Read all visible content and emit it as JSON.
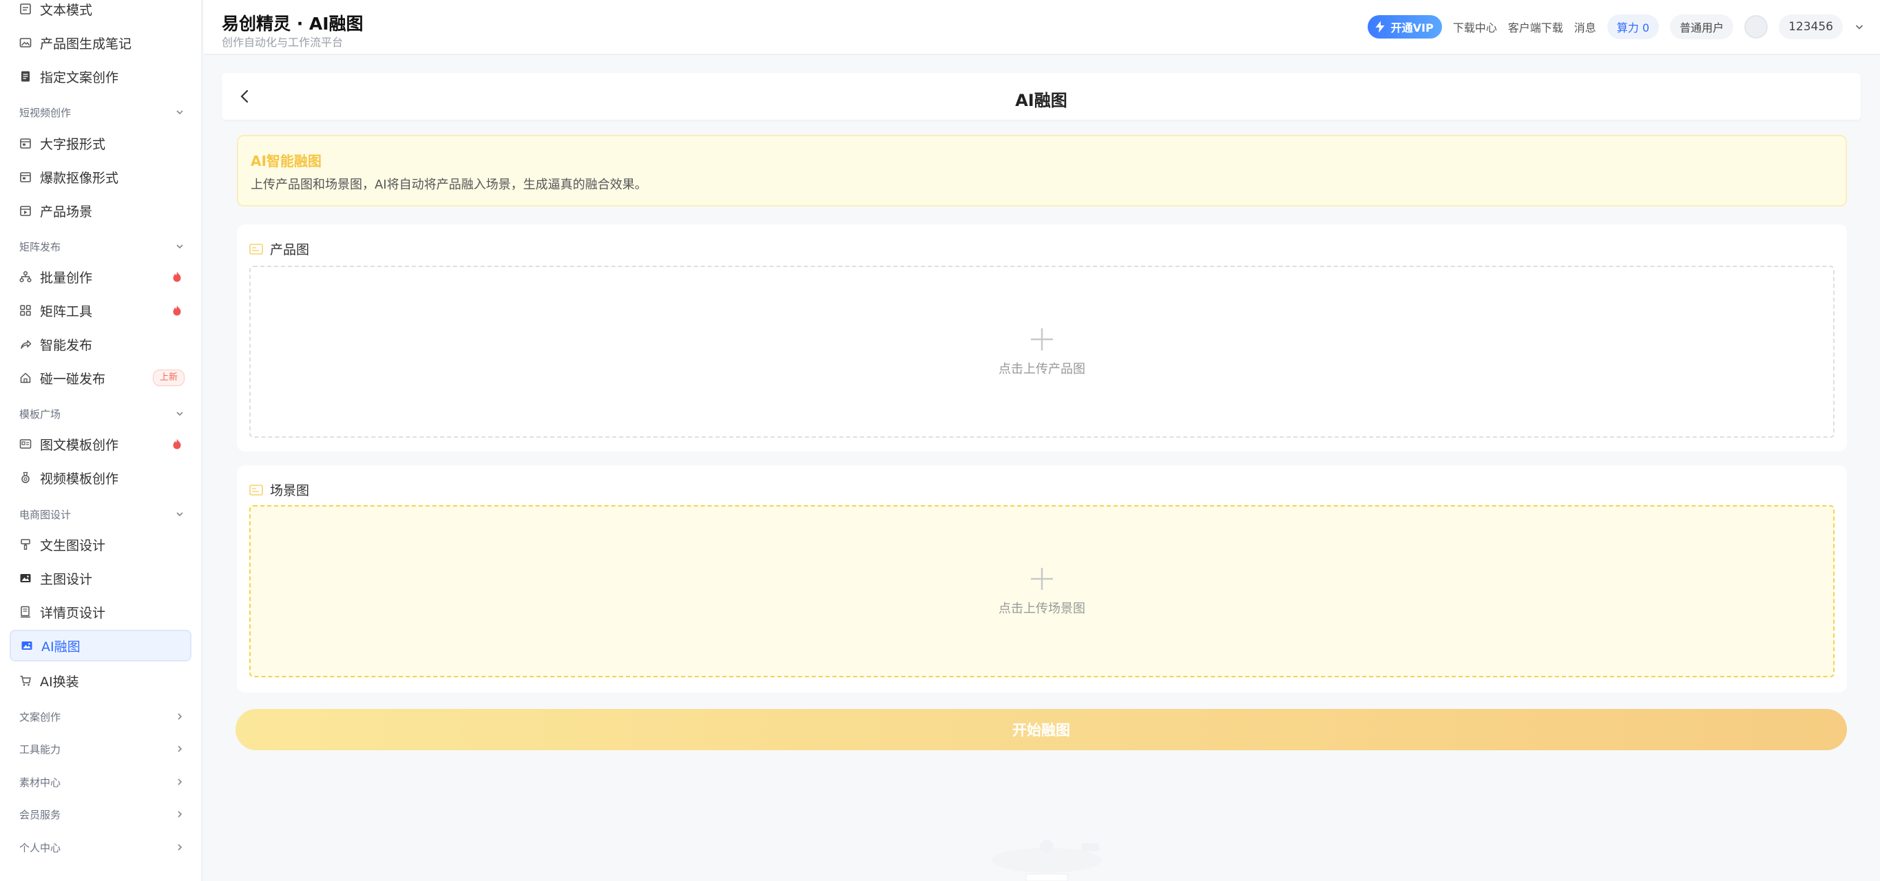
{
  "sidebar": {
    "items_top": [
      {
        "label": "文本模式",
        "icon": "document-icon"
      },
      {
        "label": "产品图生成笔记",
        "icon": "image-icon"
      },
      {
        "label": "指定文案创作",
        "icon": "file-icon"
      }
    ],
    "group_video": "短视频创作",
    "items_video": [
      {
        "label": "大字报形式",
        "icon": "calendar-icon"
      },
      {
        "label": "爆款抠像形式",
        "icon": "calendar-icon"
      },
      {
        "label": "产品场景",
        "icon": "calendar-play-icon"
      }
    ],
    "group_matrix": "矩阵发布",
    "items_matrix": [
      {
        "label": "批量创作",
        "icon": "hierarchy-icon"
      },
      {
        "label": "矩阵工具",
        "icon": "grid-icon"
      },
      {
        "label": "智能发布",
        "icon": "share-icon"
      },
      {
        "label": "碰一碰发布",
        "icon": "home-icon",
        "badge": "上新"
      }
    ],
    "group_template": "模板广场",
    "items_template": [
      {
        "label": "图文模板创作",
        "icon": "card-icon"
      },
      {
        "label": "视频模板创作",
        "icon": "medal-icon"
      }
    ],
    "group_ecom": "电商图设计",
    "items_ecom": [
      {
        "label": "文生图设计",
        "icon": "brush-icon"
      },
      {
        "label": "主图设计",
        "icon": "picture-icon"
      },
      {
        "label": "详情页设计",
        "icon": "detail-icon"
      },
      {
        "label": "AI融图",
        "icon": "picture-icon"
      },
      {
        "label": "AI换装",
        "icon": "cart-icon"
      }
    ],
    "groups_collapsed": [
      "文案创作",
      "工具能力",
      "素材中心",
      "会员服务",
      "个人中心"
    ]
  },
  "header": {
    "title": "易创精灵 · AI融图",
    "subtitle": "创作自动化与工作流平台",
    "vip_label": "开通VIP",
    "links": [
      "下载中心",
      "客户端下载",
      "消息"
    ],
    "power_label": "算力 0",
    "user_type": "普通用户",
    "username": "123456"
  },
  "main": {
    "page_title": "AI融图",
    "notice_title": "AI智能融图",
    "notice_text": "上传产品图和场景图，AI将自动将产品融入场景，生成逼真的融合效果。",
    "product_label": "产品图",
    "product_upload": "点击上传产品图",
    "scene_label": "场景图",
    "scene_upload": "点击上传场景图",
    "start_label": "开始融图"
  },
  "colors": {
    "accent": "#2f6bff",
    "notice_title": "#f5c542",
    "start_gradient_from": "#fbe79a",
    "start_gradient_to": "#f6cd82",
    "hot": "#f05454"
  }
}
